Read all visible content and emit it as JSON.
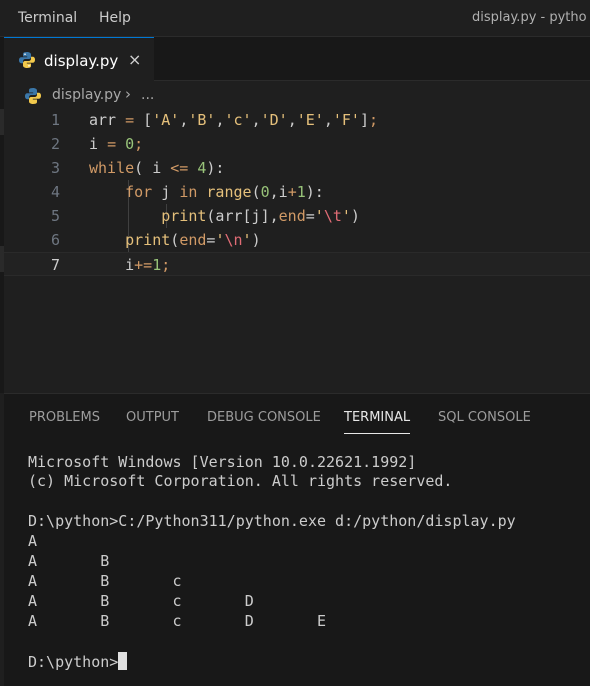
{
  "menubar": {
    "items": [
      "Terminal",
      "Help"
    ],
    "title": "display.py - pytho"
  },
  "tab": {
    "label": "display.py",
    "close": "×"
  },
  "breadcrumb": {
    "file": "display.py",
    "separator": "›",
    "more": "..."
  },
  "editor": {
    "current_line": 7,
    "lines": [
      {
        "num": "1",
        "segments": [
          [
            "v",
            "arr "
          ],
          [
            "k",
            "="
          ],
          [
            "v",
            " ["
          ],
          [
            "s",
            "'A'"
          ],
          [
            "v",
            ","
          ],
          [
            "s",
            "'B'"
          ],
          [
            "v",
            ","
          ],
          [
            "s",
            "'c'"
          ],
          [
            "v",
            ","
          ],
          [
            "s",
            "'D'"
          ],
          [
            "v",
            ","
          ],
          [
            "s",
            "'E'"
          ],
          [
            "v",
            ","
          ],
          [
            "s",
            "'F'"
          ],
          [
            "v",
            "]"
          ],
          [
            "k",
            ";"
          ]
        ]
      },
      {
        "num": "2",
        "segments": [
          [
            "v",
            "i "
          ],
          [
            "k",
            "="
          ],
          [
            "v",
            " "
          ],
          [
            "n",
            "0"
          ],
          [
            "k",
            ";"
          ]
        ]
      },
      {
        "num": "3",
        "segments": [
          [
            "k",
            "while"
          ],
          [
            "v",
            "( i "
          ],
          [
            "k",
            "<="
          ],
          [
            "v",
            " "
          ],
          [
            "n",
            "4"
          ],
          [
            "v",
            "):"
          ]
        ]
      },
      {
        "num": "4",
        "segments": [
          [
            "v",
            "    "
          ],
          [
            "k",
            "for"
          ],
          [
            "v",
            " j "
          ],
          [
            "k",
            "in"
          ],
          [
            "v",
            " "
          ],
          [
            "f",
            "range"
          ],
          [
            "v",
            "("
          ],
          [
            "n",
            "0"
          ],
          [
            "v",
            ",i"
          ],
          [
            "k",
            "+"
          ],
          [
            "n",
            "1"
          ],
          [
            "v",
            "):"
          ]
        ]
      },
      {
        "num": "5",
        "segments": [
          [
            "v",
            "        "
          ],
          [
            "f",
            "print"
          ],
          [
            "v",
            "(arr[j],"
          ],
          [
            "k",
            "end"
          ],
          [
            "v",
            "="
          ],
          [
            "s",
            "'"
          ],
          [
            "p",
            "\\t"
          ],
          [
            "s",
            "'"
          ],
          [
            "v",
            ")"
          ]
        ]
      },
      {
        "num": "6",
        "segments": [
          [
            "v",
            "    "
          ],
          [
            "f",
            "print"
          ],
          [
            "v",
            "("
          ],
          [
            "k",
            "end"
          ],
          [
            "v",
            "="
          ],
          [
            "s",
            "'"
          ],
          [
            "p",
            "\\n"
          ],
          [
            "s",
            "'"
          ],
          [
            "v",
            ")"
          ]
        ]
      },
      {
        "num": "7",
        "segments": [
          [
            "v",
            "    i"
          ],
          [
            "k",
            "+="
          ],
          [
            "n",
            "1"
          ],
          [
            "k",
            ";"
          ]
        ]
      }
    ]
  },
  "panel": {
    "tabs": [
      "PROBLEMS",
      "OUTPUT",
      "DEBUG CONSOLE",
      "TERMINAL",
      "SQL CONSOLE"
    ],
    "active_tab": "TERMINAL"
  },
  "terminal": {
    "header1": "Microsoft Windows [Version 10.0.22621.1992]",
    "header2": "(c) Microsoft Corporation. All rights reserved.",
    "command": "D:\\python>C:/Python311/python.exe d:/python/display.py",
    "output": [
      "A",
      "A       B",
      "A       B       c",
      "A       B       c       D",
      "A       B       c       D       E"
    ],
    "prompt": "D:\\python>"
  },
  "colors": {
    "accent": "#0078d4",
    "background": "#1f1f1f",
    "panel": "#181818"
  },
  "icons": [
    "python-file-icon",
    "close-icon",
    "chevron-right-icon"
  ]
}
